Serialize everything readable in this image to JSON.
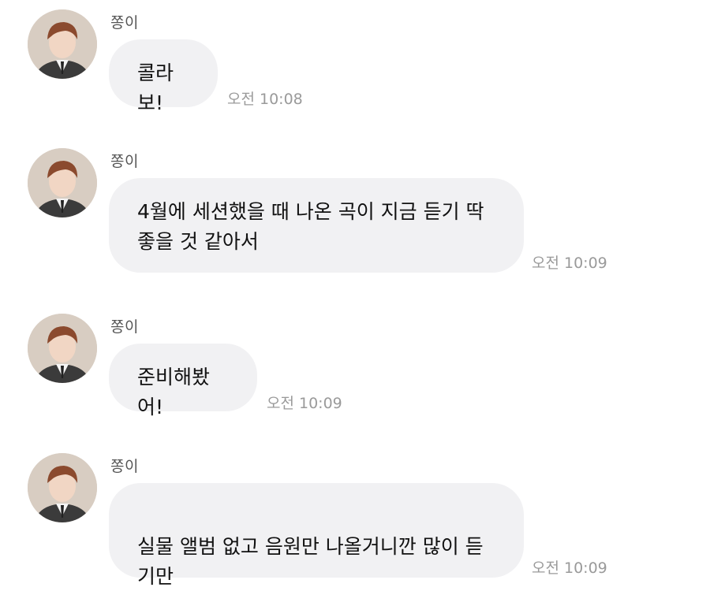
{
  "messages": [
    {
      "sender": "쫑이",
      "text": "콜라보!",
      "time": "오전 10:08"
    },
    {
      "sender": "쫑이",
      "text": "4월에 세션했을 때 나온 곡이 지금 듣기 딱\n좋을 것 같아서",
      "time": "오전 10:09"
    },
    {
      "sender": "쫑이",
      "text": "준비해봤어!",
      "time": "오전 10:09"
    },
    {
      "sender": "쫑이",
      "text": "실물 앨범 없고 음원만 나올거니깐 많이 듣기만\n해줘",
      "emoji": "smiling-face-icon",
      "time": "오전 10:09"
    }
  ],
  "colors": {
    "bubble": "#f1f1f3",
    "time": "#9a9a9a",
    "sender": "#555555",
    "text": "#111111"
  }
}
